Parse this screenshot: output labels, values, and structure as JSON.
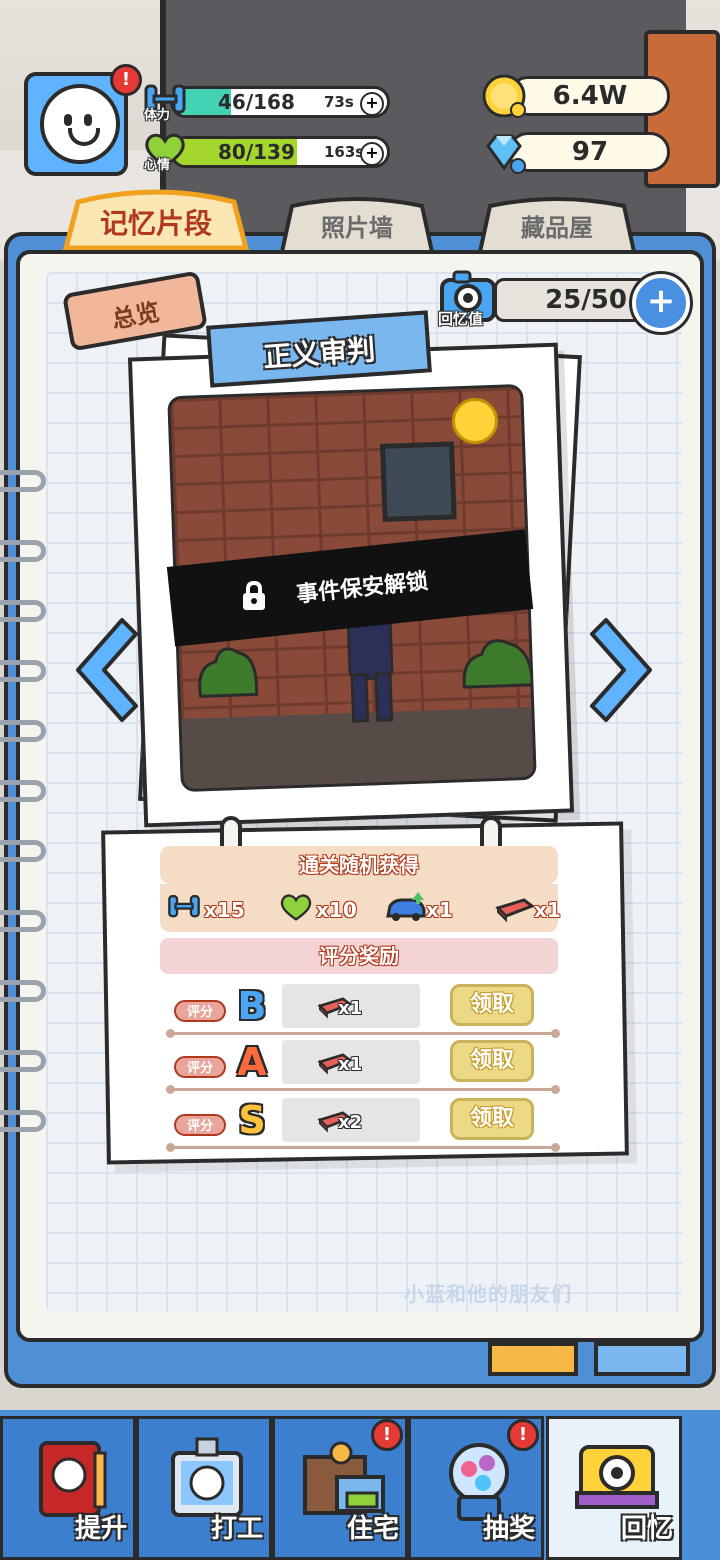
{
  "player": {
    "alert_badge": "!",
    "stamina": {
      "label": "体力",
      "value": "46/168",
      "timer": "73s",
      "fill": 0.27,
      "color": "#43d3b4"
    },
    "mood": {
      "label": "心情",
      "value": "80/139",
      "timer": "163s",
      "fill": 0.58,
      "color": "#a5d62b"
    }
  },
  "currency": {
    "coins": "6.4W",
    "gems": "97"
  },
  "top_tabs": [
    {
      "label": "记忆片段",
      "active": true
    },
    {
      "label": "照片墙",
      "active": false
    },
    {
      "label": "藏品屋",
      "active": false
    }
  ],
  "overview_tag": "总览",
  "memory": {
    "icon_label": "回忆值",
    "value": "25/50",
    "plus": "+"
  },
  "photo": {
    "title": "正义审判",
    "lock_text": "事件保安解锁"
  },
  "rewards": {
    "clear_header": "通关随机获得",
    "clear_items": [
      {
        "icon": "dumbbell-icon",
        "qty": "x15"
      },
      {
        "icon": "heart-icon",
        "qty": "x10"
      },
      {
        "icon": "car-upgrade-icon",
        "qty": "x1"
      },
      {
        "icon": "brick-icon",
        "qty": "x1"
      }
    ],
    "score_header": "评分奖励",
    "score_rows": [
      {
        "tag": "评分",
        "grade": "B",
        "grade_color": "#4aa5f2",
        "qty": "x1",
        "claim": "领取"
      },
      {
        "tag": "评分",
        "grade": "A",
        "grade_color": "#ff6a3d",
        "qty": "x1",
        "claim": "领取"
      },
      {
        "tag": "评分",
        "grade": "S",
        "grade_color": "#ffc23a",
        "qty": "x2",
        "claim": "领取"
      }
    ]
  },
  "footer_text": "小蓝和他的朋友们",
  "bottom_nav": [
    {
      "label": "提升",
      "badge": false,
      "active": false
    },
    {
      "label": "打工",
      "badge": false,
      "active": false
    },
    {
      "label": "住宅",
      "badge": true,
      "active": false
    },
    {
      "label": "抽奖",
      "badge": true,
      "active": false
    },
    {
      "label": "回忆",
      "badge": false,
      "active": true
    }
  ]
}
